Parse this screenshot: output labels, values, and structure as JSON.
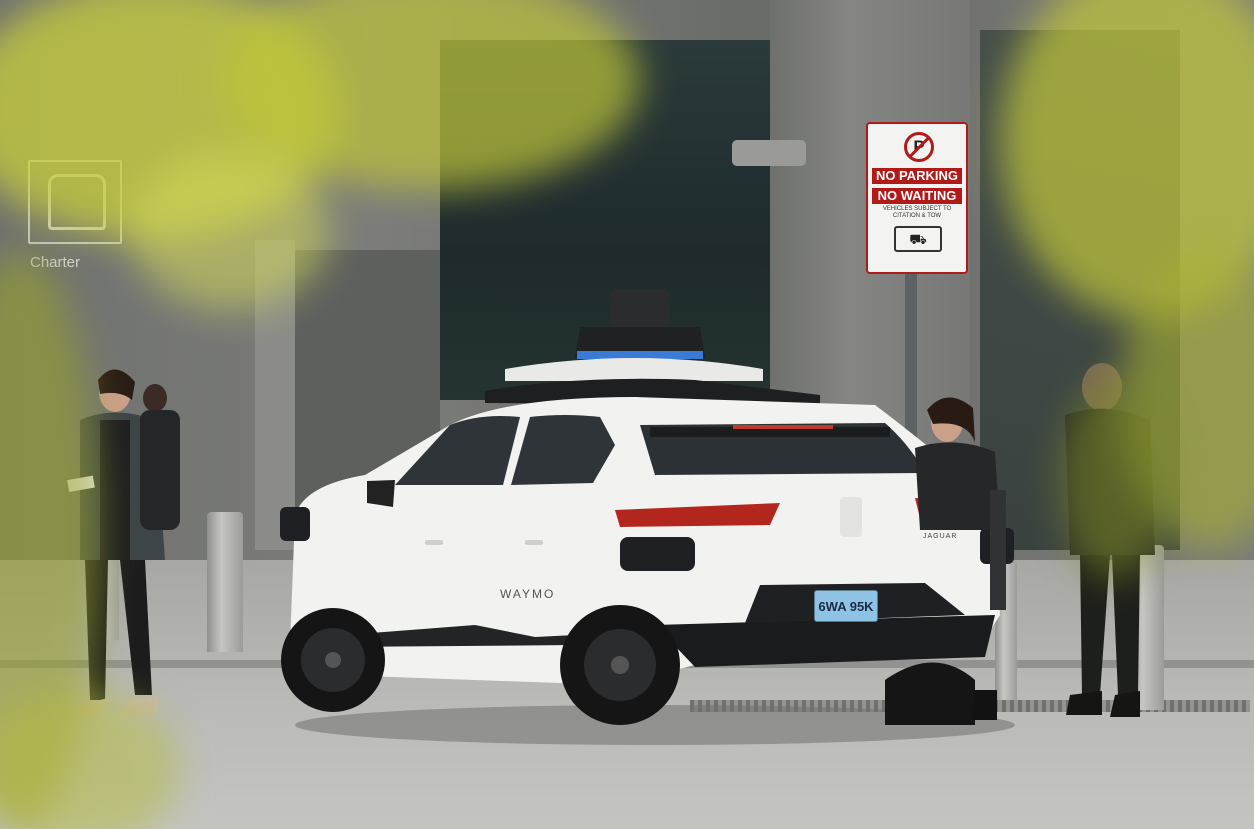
{
  "scene": {
    "charter_sign": {
      "label": "Charter",
      "icon": "bus-icon"
    },
    "parking_sign": {
      "icon": "no-parking-icon",
      "line1": "NO PARKING",
      "line2": "NO WAITING",
      "fine_print": "VEHICLES SUBJECT TO CITATION & TOW",
      "tow_icon": "tow-truck-icon"
    },
    "vehicle": {
      "side_badge": "WAYMO",
      "rear_badge": "JAGUAR",
      "license_plate": "6WA 95K",
      "body_color": "#f2f2f0",
      "sensor_accent": "#3a7bd5"
    },
    "palette": {
      "foliage": "#c8cf3a",
      "sign_red": "#b21a1a"
    }
  }
}
